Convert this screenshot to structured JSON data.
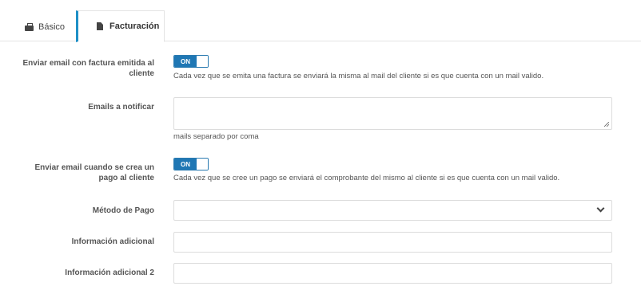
{
  "tabs": [
    {
      "label": "Básico",
      "icon": "briefcase-icon"
    },
    {
      "label": "Facturación",
      "icon": "file-icon"
    }
  ],
  "form": {
    "send_invoice_email": {
      "label": "Enviar email con factura emitida al cliente",
      "toggle": "ON",
      "help": "Cada vez que se emita una factura se enviará la misma al mail del cliente si es que cuenta con un mail valido."
    },
    "emails_notify": {
      "label": "Emails a notificar",
      "value": "",
      "help": "mails separado por coma"
    },
    "send_payment_email": {
      "label": "Enviar email cuando se crea un pago al cliente",
      "toggle": "ON",
      "help": "Cada vez que se cree un pago se enviará el comprobante del mismo al cliente si es que cuenta con un mail valido."
    },
    "payment_method": {
      "label": "Método de Pago",
      "value": ""
    },
    "additional_info": {
      "label": "Información adicional",
      "value": ""
    },
    "additional_info_2": {
      "label": "Información adicional 2",
      "value": ""
    }
  },
  "colors": {
    "accent": "#1f77b4",
    "tab_active_border": "#1e8fc6",
    "border": "#dcdcdc"
  }
}
